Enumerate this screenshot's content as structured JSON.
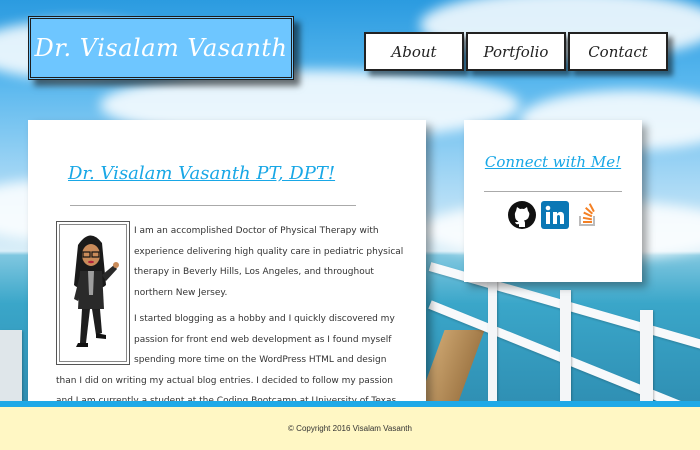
{
  "header": {
    "logo": "Dr. Visalam Vasanth",
    "nav": [
      {
        "label": "About"
      },
      {
        "label": "Portfolio"
      },
      {
        "label": "Contact"
      }
    ]
  },
  "about": {
    "title": "Dr. Visalam Vasanth PT, DPT!",
    "paragraphs": [
      "I am an accomplished Doctor of Physical Therapy with experience delivering high quality care in pediatric physical therapy in Beverly Hills, Los Angeles, and throughout northern New Jersey.",
      "I started blogging as a hobby and I quickly discovered my passion for front end web development as I found myself spending more time on the WordPress HTML and design than I did on writing my actual blog entries. I decided to follow my passion and I am currently a student at the Coding Bootcamp at University of Texas Austin."
    ]
  },
  "connect": {
    "title": "Connect with Me!",
    "icons": [
      "github-icon",
      "linkedin-icon",
      "stackoverflow-icon"
    ]
  },
  "footer": {
    "copyright": "© Copyright 2016 Visalam Vasanth"
  },
  "colors": {
    "accent": "#18a7e6",
    "logo_bg": "#6ec6ff",
    "footer_bg": "#fff7c4",
    "footer_stripe": "#1fa9e7"
  }
}
